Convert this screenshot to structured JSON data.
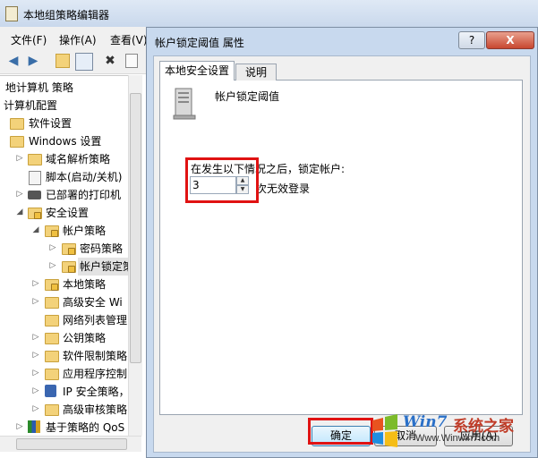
{
  "parent_window": {
    "title": "本地组策略编辑器"
  },
  "menubar": {
    "file": "文件(F)",
    "action": "操作(A)",
    "view": "查看(V)"
  },
  "toolbar": {
    "back": "◀",
    "forward": "▶",
    "delete": "✖"
  },
  "tree": {
    "items": [
      {
        "label": "地计算机 策略"
      },
      {
        "label": "计算机配置"
      },
      {
        "label": "软件设置"
      },
      {
        "label": "Windows 设置"
      },
      {
        "label": "域名解析策略"
      },
      {
        "label": "脚本(启动/关机)"
      },
      {
        "label": "已部署的打印机"
      },
      {
        "label": "安全设置"
      },
      {
        "label": "帐户策略"
      },
      {
        "label": "密码策略"
      },
      {
        "label": "帐户锁定策"
      },
      {
        "label": "本地策略"
      },
      {
        "label": "高级安全 Wi"
      },
      {
        "label": "网络列表管理"
      },
      {
        "label": "公钥策略"
      },
      {
        "label": "软件限制策略"
      },
      {
        "label": "应用程序控制"
      },
      {
        "label": "IP 安全策略，"
      },
      {
        "label": "高级审核策略"
      },
      {
        "label": "基于策略的 QoS"
      }
    ]
  },
  "dialog": {
    "title": "帐户锁定阈值 属性",
    "help_label": "?",
    "close_label": "X",
    "tabs": [
      {
        "label": "本地安全设置"
      },
      {
        "label": "说明"
      }
    ],
    "policy_name": "帐户锁定阈值",
    "lockout_label": "在发生以下情况之后，锁定帐户:",
    "lockout_count": "3",
    "lockout_suffix": "次无效登录",
    "ok_label": "确定",
    "cancel_label": "取消",
    "apply_label": "应用(A)"
  },
  "watermark": {
    "brand": "Win7",
    "brand_cn": "系统之家",
    "url": "Www.Winwin7.com"
  },
  "colors": {
    "highlight_box": "#e01212",
    "dialog_frame": "#c8d9ee"
  }
}
